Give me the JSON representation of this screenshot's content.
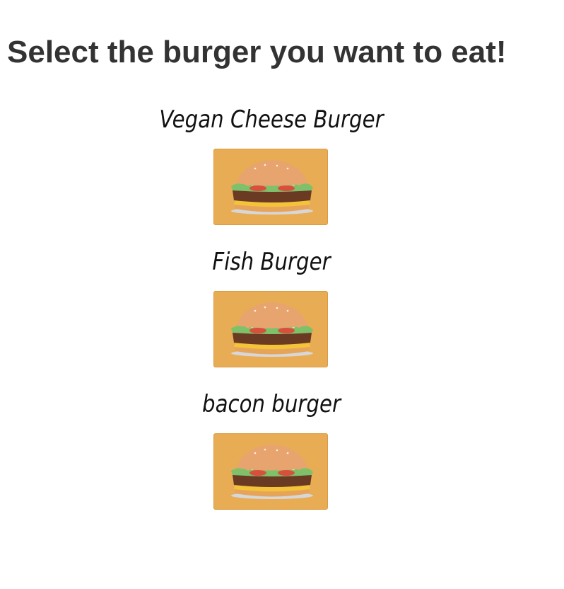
{
  "page": {
    "title": "Select the burger you want to eat!"
  },
  "burgers": [
    {
      "name": "Vegan Cheese Burger",
      "image": "burger-icon"
    },
    {
      "name": "Fish Burger",
      "image": "burger-icon"
    },
    {
      "name": "bacon burger",
      "image": "burger-icon"
    }
  ],
  "colors": {
    "title": "#333333",
    "card_background": "#e8ac55"
  }
}
